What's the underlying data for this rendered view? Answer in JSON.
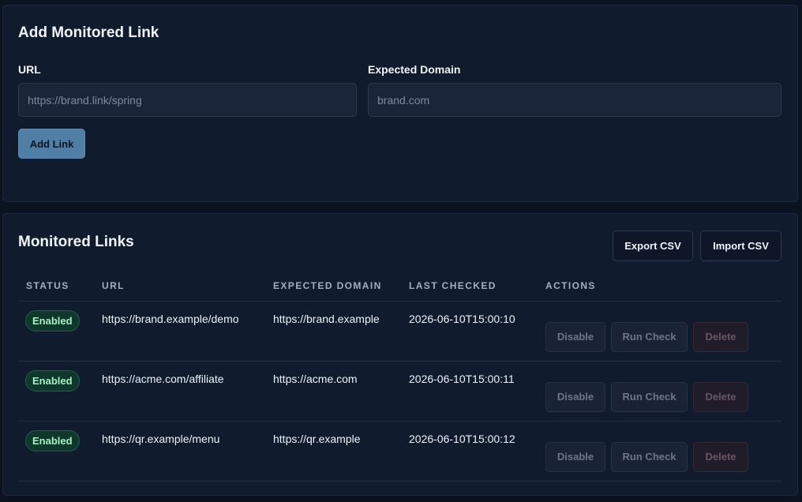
{
  "add_card": {
    "title": "Add Monitored Link",
    "url_label": "URL",
    "url_placeholder": "https://brand.link/spring",
    "url_value": "",
    "domain_label": "Expected Domain",
    "domain_placeholder": "brand.com",
    "domain_value": "",
    "add_button": "Add Link"
  },
  "list_card": {
    "title": "Monitored Links",
    "export_button": "Export CSV",
    "import_button": "Import CSV",
    "columns": [
      "STATUS",
      "URL",
      "EXPECTED DOMAIN",
      "LAST CHECKED",
      "ACTIONS"
    ],
    "rows": [
      {
        "status": "Enabled",
        "url": "https://brand.example/demo",
        "expected_domain": "https://brand.example",
        "last_checked": "2026-06-10T15:00:10",
        "actions": {
          "disable": "Disable",
          "run_check": "Run Check",
          "delete": "Delete"
        }
      },
      {
        "status": "Enabled",
        "url": "https://acme.com/affiliate",
        "expected_domain": "https://acme.com",
        "last_checked": "2026-06-10T15:00:11",
        "actions": {
          "disable": "Disable",
          "run_check": "Run Check",
          "delete": "Delete"
        }
      },
      {
        "status": "Enabled",
        "url": "https://qr.example/menu",
        "expected_domain": "https://qr.example",
        "last_checked": "2026-06-10T15:00:12",
        "actions": {
          "disable": "Disable",
          "run_check": "Run Check",
          "delete": "Delete"
        }
      }
    ]
  },
  "colors": {
    "background": "#0b1220",
    "card": "#111b2e",
    "primary_button": "#4f7ea6",
    "badge_enabled_text": "#a6f0c4",
    "badge_enabled_bg": "#10372b"
  }
}
